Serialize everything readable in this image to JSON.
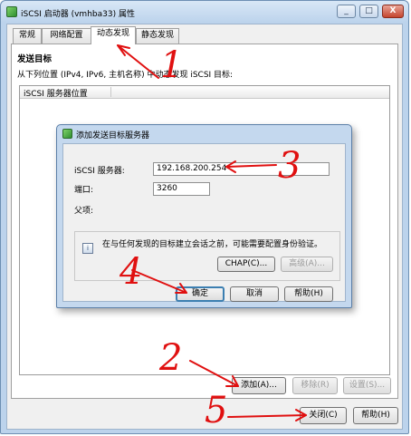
{
  "window": {
    "title": "iSCSI 启动器 (vmhba33) 属性",
    "controls": {
      "minimize": "_",
      "maximize": "□",
      "close": "X"
    }
  },
  "tabs": [
    {
      "label": "常规"
    },
    {
      "label": "网络配置"
    },
    {
      "label": "动态发现",
      "active": true
    },
    {
      "label": "静态发现"
    }
  ],
  "panel": {
    "section_title": "发送目标",
    "description": "从下列位置 (IPv4, IPv6, 主机名称) 中动态发现 iSCSI 目标:",
    "list_header": "iSCSI 服务器位置",
    "buttons": {
      "add": "添加(A)...",
      "remove": "移除(R)",
      "settings": "设置(S)..."
    }
  },
  "footer": {
    "close": "关闭(C)",
    "help": "帮助(H)"
  },
  "dialog": {
    "title": "添加发送目标服务器",
    "server_label": "iSCSI 服务器:",
    "server_value": "192.168.200.254",
    "port_label": "端口:",
    "port_value": "3260",
    "parent_label": "父项:",
    "info_text": "在与任何发现的目标建立会话之前，可能需要配置身份验证。",
    "chap_button": "CHAP(C)...",
    "advanced_button": "高级(A)...",
    "ok_button": "确定",
    "cancel_button": "取消",
    "help_button": "帮助(H)"
  },
  "annotations": {
    "color": "#e01010",
    "step_labels": [
      "1",
      "2",
      "3",
      "4",
      "5"
    ]
  },
  "colors": {
    "title_bar": "#bcd3ec",
    "close_button": "#c4452e",
    "default_button_border": "#3c7fb1"
  }
}
